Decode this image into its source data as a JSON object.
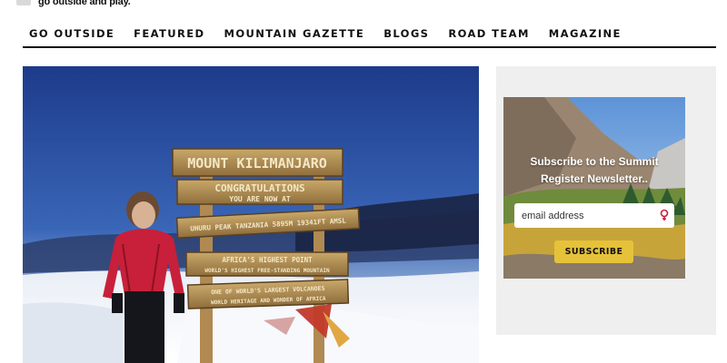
{
  "site": {
    "tagline": "go outside and play."
  },
  "nav": {
    "items": [
      {
        "label": "GO OUTSIDE"
      },
      {
        "label": "FEATURED"
      },
      {
        "label": "MOUNTAIN GAZETTE"
      },
      {
        "label": "BLOGS"
      },
      {
        "label": "ROAD TEAM"
      },
      {
        "label": "MAGAZINE"
      }
    ]
  },
  "hero": {
    "sign_lines": [
      "MOUNT KILIMANJARO",
      "CONGRATULATIONS",
      "YOU ARE NOW AT",
      "UHURU PEAK TANZANIA 5895M 19341FT AMSL",
      "AFRICA'S HIGHEST POINT",
      "WORLD'S HIGHEST FREE-STANDING MOUNTAIN",
      "ONE OF WORLD'S LARGEST VOLCANOES",
      "WORLD HERITAGE AND WONDER OF AFRICA"
    ]
  },
  "sidebar": {
    "newsletter": {
      "title_line1": "Subscribe to the Summit",
      "title_line2": "Register Newsletter..",
      "email_placeholder": "email address",
      "button_label": "SUBSCRIBE"
    }
  },
  "colors": {
    "nav_text": "#111111",
    "sidebar_bg": "#efefef",
    "button_bg": "#e6c23a",
    "sky_top": "#1f3e8c",
    "jacket": "#c8203a"
  }
}
